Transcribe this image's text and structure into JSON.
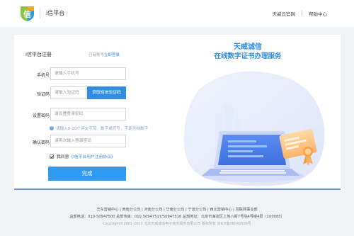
{
  "header": {
    "logo_char": "信",
    "brand_title": "i信平台",
    "links": [
      "天威云官网",
      "帮助中心"
    ]
  },
  "form": {
    "title": "i信平台注册",
    "have_account_text": "已有账号",
    "login_link": "立即登录",
    "phone": {
      "label": "手机号",
      "placeholder": "请输入手机号"
    },
    "code": {
      "label": "验证码",
      "placeholder": "请输入验证码",
      "button": "获取短信验证码"
    },
    "password": {
      "label": "设置密码",
      "placeholder": "请设置登录密码"
    },
    "confirm": {
      "label": "确认密码",
      "placeholder": "请再次输入登录密码"
    },
    "hint": "请输入8-20个英文字母、数字或符号，不能含纯数字",
    "hint_icon": "i",
    "agree_prefix": "我同意",
    "agree_link": "《i信平台用户注册协议》",
    "submit": "完成"
  },
  "illustration": {
    "title": "天威诚信",
    "subtitle": "在线数字证书办理服务"
  },
  "footer": {
    "line1": "华东营销中心 | 西南分公司 | 河南分公司 | 华南分公司 | 宁波分公司 | 西北营销中心 | 互联网事业部",
    "line2": "总部电话：010-50947500  总部传真：010-50947517/50947516  总部地址：北京市海淀区上地八街7号院4号楼4层（100085）",
    "line3": "Copyright©2001-2013 北京天威诚信电子商务服务有限公司 版权所有 京ICP备06042509号"
  },
  "colors": {
    "accent": "#2f8de4",
    "button": "#2f9af0",
    "background": "#f1f3f6"
  }
}
